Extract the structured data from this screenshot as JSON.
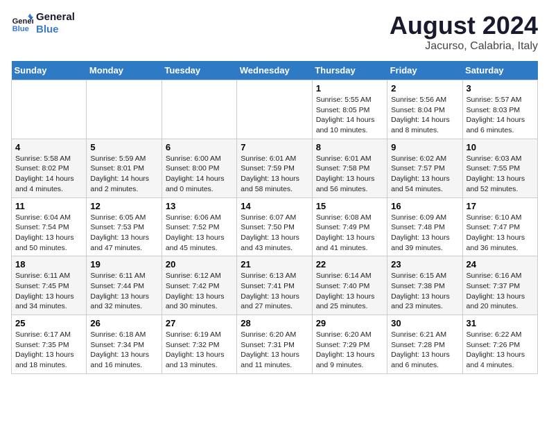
{
  "header": {
    "logo_line1": "General",
    "logo_line2": "Blue",
    "month": "August 2024",
    "location": "Jacurso, Calabria, Italy"
  },
  "weekdays": [
    "Sunday",
    "Monday",
    "Tuesday",
    "Wednesday",
    "Thursday",
    "Friday",
    "Saturday"
  ],
  "weeks": [
    [
      {
        "day": "",
        "info": ""
      },
      {
        "day": "",
        "info": ""
      },
      {
        "day": "",
        "info": ""
      },
      {
        "day": "",
        "info": ""
      },
      {
        "day": "1",
        "info": "Sunrise: 5:55 AM\nSunset: 8:05 PM\nDaylight: 14 hours\nand 10 minutes."
      },
      {
        "day": "2",
        "info": "Sunrise: 5:56 AM\nSunset: 8:04 PM\nDaylight: 14 hours\nand 8 minutes."
      },
      {
        "day": "3",
        "info": "Sunrise: 5:57 AM\nSunset: 8:03 PM\nDaylight: 14 hours\nand 6 minutes."
      }
    ],
    [
      {
        "day": "4",
        "info": "Sunrise: 5:58 AM\nSunset: 8:02 PM\nDaylight: 14 hours\nand 4 minutes."
      },
      {
        "day": "5",
        "info": "Sunrise: 5:59 AM\nSunset: 8:01 PM\nDaylight: 14 hours\nand 2 minutes."
      },
      {
        "day": "6",
        "info": "Sunrise: 6:00 AM\nSunset: 8:00 PM\nDaylight: 14 hours\nand 0 minutes."
      },
      {
        "day": "7",
        "info": "Sunrise: 6:01 AM\nSunset: 7:59 PM\nDaylight: 13 hours\nand 58 minutes."
      },
      {
        "day": "8",
        "info": "Sunrise: 6:01 AM\nSunset: 7:58 PM\nDaylight: 13 hours\nand 56 minutes."
      },
      {
        "day": "9",
        "info": "Sunrise: 6:02 AM\nSunset: 7:57 PM\nDaylight: 13 hours\nand 54 minutes."
      },
      {
        "day": "10",
        "info": "Sunrise: 6:03 AM\nSunset: 7:55 PM\nDaylight: 13 hours\nand 52 minutes."
      }
    ],
    [
      {
        "day": "11",
        "info": "Sunrise: 6:04 AM\nSunset: 7:54 PM\nDaylight: 13 hours\nand 50 minutes."
      },
      {
        "day": "12",
        "info": "Sunrise: 6:05 AM\nSunset: 7:53 PM\nDaylight: 13 hours\nand 47 minutes."
      },
      {
        "day": "13",
        "info": "Sunrise: 6:06 AM\nSunset: 7:52 PM\nDaylight: 13 hours\nand 45 minutes."
      },
      {
        "day": "14",
        "info": "Sunrise: 6:07 AM\nSunset: 7:50 PM\nDaylight: 13 hours\nand 43 minutes."
      },
      {
        "day": "15",
        "info": "Sunrise: 6:08 AM\nSunset: 7:49 PM\nDaylight: 13 hours\nand 41 minutes."
      },
      {
        "day": "16",
        "info": "Sunrise: 6:09 AM\nSunset: 7:48 PM\nDaylight: 13 hours\nand 39 minutes."
      },
      {
        "day": "17",
        "info": "Sunrise: 6:10 AM\nSunset: 7:47 PM\nDaylight: 13 hours\nand 36 minutes."
      }
    ],
    [
      {
        "day": "18",
        "info": "Sunrise: 6:11 AM\nSunset: 7:45 PM\nDaylight: 13 hours\nand 34 minutes."
      },
      {
        "day": "19",
        "info": "Sunrise: 6:11 AM\nSunset: 7:44 PM\nDaylight: 13 hours\nand 32 minutes."
      },
      {
        "day": "20",
        "info": "Sunrise: 6:12 AM\nSunset: 7:42 PM\nDaylight: 13 hours\nand 30 minutes."
      },
      {
        "day": "21",
        "info": "Sunrise: 6:13 AM\nSunset: 7:41 PM\nDaylight: 13 hours\nand 27 minutes."
      },
      {
        "day": "22",
        "info": "Sunrise: 6:14 AM\nSunset: 7:40 PM\nDaylight: 13 hours\nand 25 minutes."
      },
      {
        "day": "23",
        "info": "Sunrise: 6:15 AM\nSunset: 7:38 PM\nDaylight: 13 hours\nand 23 minutes."
      },
      {
        "day": "24",
        "info": "Sunrise: 6:16 AM\nSunset: 7:37 PM\nDaylight: 13 hours\nand 20 minutes."
      }
    ],
    [
      {
        "day": "25",
        "info": "Sunrise: 6:17 AM\nSunset: 7:35 PM\nDaylight: 13 hours\nand 18 minutes."
      },
      {
        "day": "26",
        "info": "Sunrise: 6:18 AM\nSunset: 7:34 PM\nDaylight: 13 hours\nand 16 minutes."
      },
      {
        "day": "27",
        "info": "Sunrise: 6:19 AM\nSunset: 7:32 PM\nDaylight: 13 hours\nand 13 minutes."
      },
      {
        "day": "28",
        "info": "Sunrise: 6:20 AM\nSunset: 7:31 PM\nDaylight: 13 hours\nand 11 minutes."
      },
      {
        "day": "29",
        "info": "Sunrise: 6:20 AM\nSunset: 7:29 PM\nDaylight: 13 hours\nand 9 minutes."
      },
      {
        "day": "30",
        "info": "Sunrise: 6:21 AM\nSunset: 7:28 PM\nDaylight: 13 hours\nand 6 minutes."
      },
      {
        "day": "31",
        "info": "Sunrise: 6:22 AM\nSunset: 7:26 PM\nDaylight: 13 hours\nand 4 minutes."
      }
    ]
  ]
}
